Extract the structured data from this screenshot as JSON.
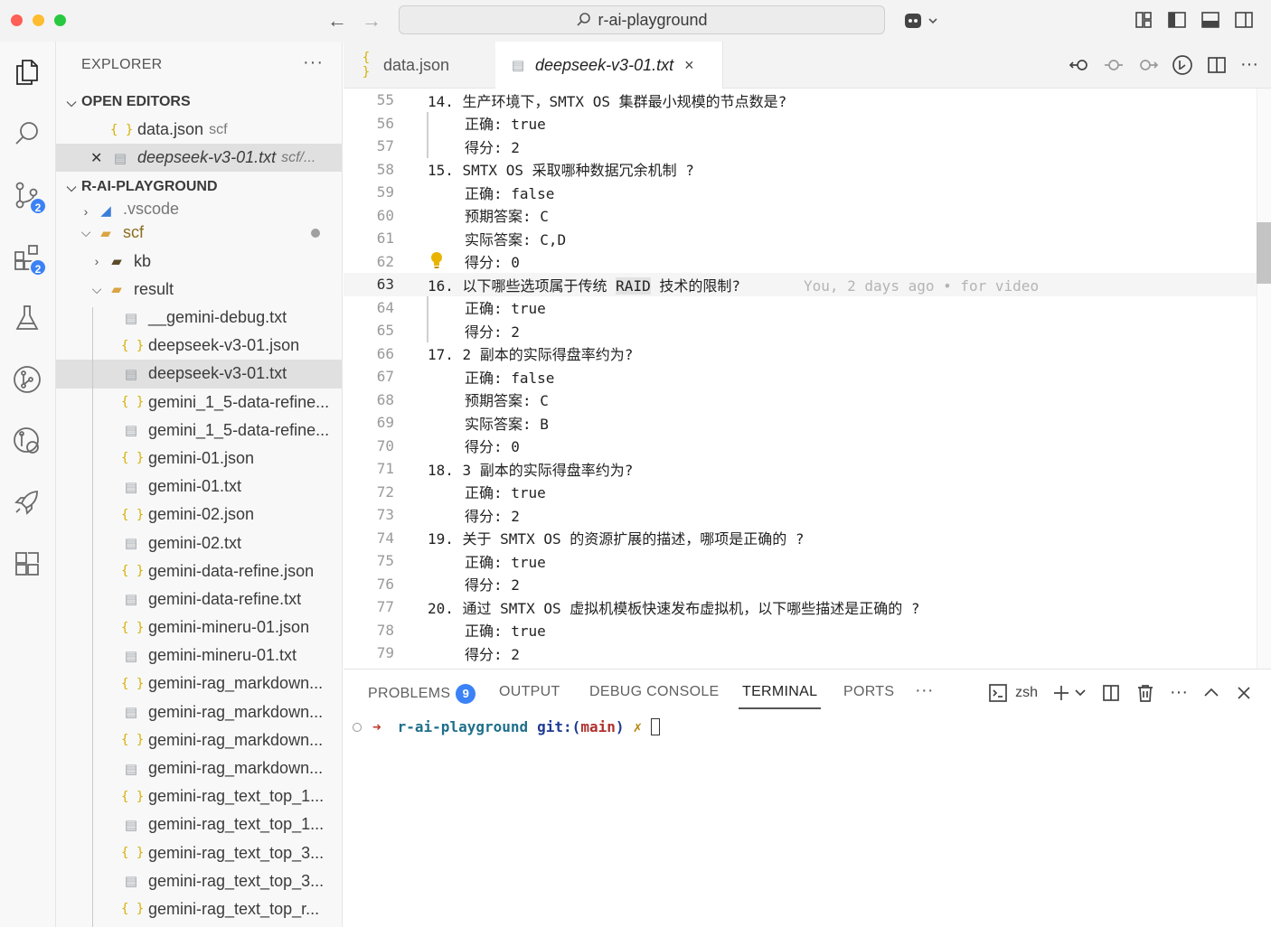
{
  "window": {
    "search_label": "r-ai-playground"
  },
  "activity": {
    "scm_badge": "2",
    "extensions_badge": "2"
  },
  "sidebar": {
    "title": "EXPLORER",
    "more": "···",
    "open_editors_title": "OPEN EDITORS",
    "open_editors": [
      {
        "name": "data.json",
        "path": "scf"
      },
      {
        "name": "deepseek-v3-01.txt",
        "path": "scf/..."
      }
    ],
    "project_title": "R-AI-PLAYGROUND",
    "folders": {
      "vscode": ".vscode",
      "scf": "scf",
      "kb": "kb",
      "result": "result"
    },
    "files": [
      {
        "name": "__gemini-debug.txt",
        "type": "txt"
      },
      {
        "name": "deepseek-v3-01.json",
        "type": "json"
      },
      {
        "name": "deepseek-v3-01.txt",
        "type": "txt"
      },
      {
        "name": "gemini_1_5-data-refine...",
        "type": "json"
      },
      {
        "name": "gemini_1_5-data-refine...",
        "type": "txt"
      },
      {
        "name": "gemini-01.json",
        "type": "json"
      },
      {
        "name": "gemini-01.txt",
        "type": "txt"
      },
      {
        "name": "gemini-02.json",
        "type": "json"
      },
      {
        "name": "gemini-02.txt",
        "type": "txt"
      },
      {
        "name": "gemini-data-refine.json",
        "type": "json"
      },
      {
        "name": "gemini-data-refine.txt",
        "type": "txt"
      },
      {
        "name": "gemini-mineru-01.json",
        "type": "json"
      },
      {
        "name": "gemini-mineru-01.txt",
        "type": "txt"
      },
      {
        "name": "gemini-rag_markdown...",
        "type": "json"
      },
      {
        "name": "gemini-rag_markdown...",
        "type": "txt"
      },
      {
        "name": "gemini-rag_markdown...",
        "type": "json"
      },
      {
        "name": "gemini-rag_markdown...",
        "type": "txt"
      },
      {
        "name": "gemini-rag_text_top_1...",
        "type": "json"
      },
      {
        "name": "gemini-rag_text_top_1...",
        "type": "txt"
      },
      {
        "name": "gemini-rag_text_top_3...",
        "type": "json"
      },
      {
        "name": "gemini-rag_text_top_3...",
        "type": "txt"
      },
      {
        "name": "gemini-rag_text_top_r...",
        "type": "json"
      }
    ]
  },
  "tabs": [
    {
      "label": "data.json"
    },
    {
      "label": "deepseek-v3-01.txt",
      "close": "×"
    }
  ],
  "editor": {
    "lines": [
      {
        "n": "55",
        "text": "14. 生产环境下，SMTX OS 集群最小规模的节点数是?",
        "indent": false
      },
      {
        "n": "56",
        "text": "正确: true",
        "indent": true
      },
      {
        "n": "57",
        "text": "得分: 2",
        "indent": true
      },
      {
        "n": "58",
        "text": "15. SMTX OS 采取哪种数据冗余机制 ?",
        "indent": false
      },
      {
        "n": "59",
        "text": "正确: false",
        "indent": true
      },
      {
        "n": "60",
        "text": "预期答案: C",
        "indent": true
      },
      {
        "n": "61",
        "text": "实际答案: C,D",
        "indent": true
      },
      {
        "n": "62",
        "text": "得分: 0",
        "indent": true
      },
      {
        "n": "63",
        "text": "16. 以下哪些选项属于传统 RAID 技术的限制?",
        "indent": false
      },
      {
        "n": "64",
        "text": "正确: true",
        "indent": true
      },
      {
        "n": "65",
        "text": "得分: 2",
        "indent": true
      },
      {
        "n": "66",
        "text": "17. 2 副本的实际得盘率约为?",
        "indent": false
      },
      {
        "n": "67",
        "text": "正确: false",
        "indent": true
      },
      {
        "n": "68",
        "text": "预期答案: C",
        "indent": true
      },
      {
        "n": "69",
        "text": "实际答案: B",
        "indent": true
      },
      {
        "n": "70",
        "text": "得分: 0",
        "indent": true
      },
      {
        "n": "71",
        "text": "18. 3 副本的实际得盘率约为?",
        "indent": false
      },
      {
        "n": "72",
        "text": "正确: true",
        "indent": true
      },
      {
        "n": "73",
        "text": "得分: 2",
        "indent": true
      },
      {
        "n": "74",
        "text": "19. 关于 SMTX OS 的资源扩展的描述，哪项是正确的 ?",
        "indent": false
      },
      {
        "n": "75",
        "text": "正确: true",
        "indent": true
      },
      {
        "n": "76",
        "text": "得分: 2",
        "indent": true
      },
      {
        "n": "77",
        "text": "20. 通过 SMTX OS 虚拟机模板快速发布虚拟机，以下哪些描述是正确的 ?",
        "indent": false
      },
      {
        "n": "78",
        "text": "正确: true",
        "indent": true
      },
      {
        "n": "79",
        "text": "得分: 2",
        "indent": true
      }
    ],
    "current_line": {
      "before": "16. 以下哪些选项属于传统 ",
      "highlight": "RAID",
      "after": " 技术的限制?",
      "blame": "You, 2 days ago • for video"
    }
  },
  "panel": {
    "tabs": {
      "problems": "PROBLEMS",
      "problems_count": "9",
      "output": "OUTPUT",
      "debug": "DEBUG CONSOLE",
      "terminal": "TERMINAL",
      "ports": "PORTS",
      "more": "···"
    },
    "shell": "zsh",
    "terminal": {
      "arrow": "➜",
      "dir": "r-ai-playground",
      "git": "git:(",
      "branch": "main",
      "git_close": ")",
      "dirty": "✗"
    }
  },
  "colors": {
    "accent_badge": "#3b82f6",
    "json_icon": "#d4b106",
    "selected_row": "#e4e6f1"
  }
}
